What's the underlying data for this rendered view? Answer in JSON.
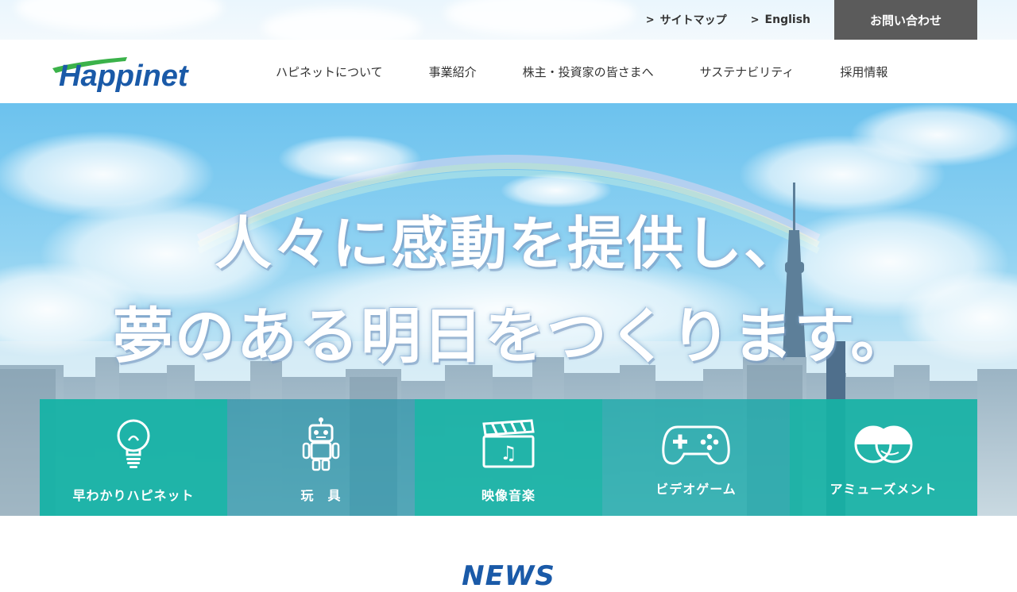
{
  "topbar": {
    "links": [
      {
        "label": "サイトマップ",
        "icon": "chevron-right-icon"
      },
      {
        "label": "English",
        "icon": "chevron-right-icon"
      }
    ],
    "contact_label": "お問い合わせ"
  },
  "header": {
    "logo_text": "Happinet",
    "nav": [
      {
        "label": "ハピネットについて"
      },
      {
        "label": "事業紹介"
      },
      {
        "label": "株主・投資家の皆さまへ"
      },
      {
        "label": "サステナビリティ"
      },
      {
        "label": "採用情報"
      }
    ]
  },
  "hero": {
    "catch_line1": "人々に感動を提供し、",
    "catch_line2": "夢のある明日をつくります。"
  },
  "tiles": [
    {
      "label": "早わかりハピネット",
      "icon": "lightbulb-icon"
    },
    {
      "label": "玩　具",
      "icon": "robot-icon"
    },
    {
      "label": "映像音楽",
      "icon": "clapperboard-music-icon"
    },
    {
      "label": "ビデオゲーム",
      "icon": "gamepad-icon"
    },
    {
      "label": "アミューズメント",
      "icon": "capsule-toy-icon"
    }
  ],
  "news": {
    "title": "NEWS"
  },
  "colors": {
    "accent_teal": "#16b2a5",
    "logo_blue": "#1a5aa8",
    "logo_green": "#3bb24a",
    "contact_bg": "#5b5b5b"
  }
}
